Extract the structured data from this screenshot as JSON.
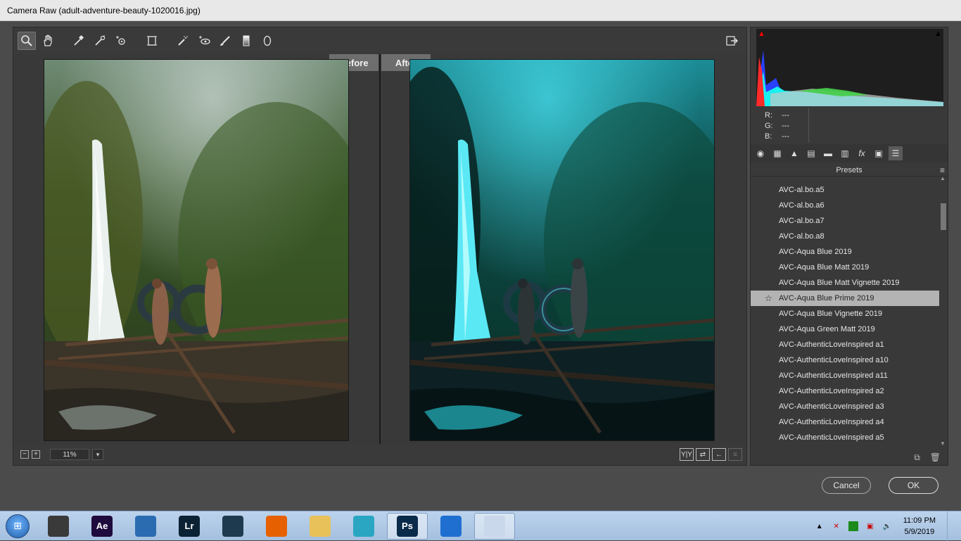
{
  "window": {
    "title": "Camera Raw (adult-adventure-beauty-1020016.jpg)"
  },
  "tools": [
    {
      "name": "zoom-tool",
      "icon": "magnifier-icon"
    },
    {
      "name": "hand-tool",
      "icon": "hand-icon"
    },
    {
      "name": "white-balance-tool",
      "icon": "eyedropper-icon"
    },
    {
      "name": "color-sampler-tool",
      "icon": "color-sampler-icon"
    },
    {
      "name": "targeted-adjustment-tool",
      "icon": "target-adjust-icon"
    },
    {
      "name": "transform-tool",
      "icon": "transform-icon"
    },
    {
      "name": "spot-removal-tool",
      "icon": "spot-removal-icon"
    },
    {
      "name": "red-eye-tool",
      "icon": "red-eye-icon"
    },
    {
      "name": "adjustment-brush-tool",
      "icon": "brush-icon"
    },
    {
      "name": "graduated-filter-tool",
      "icon": "graduated-filter-icon"
    },
    {
      "name": "radial-filter-tool",
      "icon": "radial-filter-icon"
    }
  ],
  "view": {
    "before_label": "Before",
    "after_label": "After",
    "zoom": "11%"
  },
  "readout": {
    "r_label": "R:",
    "r_value": "---",
    "g_label": "G:",
    "g_value": "---",
    "b_label": "B:",
    "b_value": "---"
  },
  "presets": {
    "title": "Presets",
    "items": [
      "AVC-al.bo.a5",
      "AVC-al.bo.a6",
      "AVC-al.bo.a7",
      "AVC-al.bo.a8",
      "AVC-Aqua Blue 2019",
      "AVC-Aqua Blue Matt 2019",
      "AVC-Aqua Blue Matt Vignette 2019",
      "AVC-Aqua Blue Prime 2019",
      "AVC-Aqua Blue Vignette 2019",
      "AVC-Aqua Green Matt 2019",
      "AVC-AuthenticLoveInspired a1",
      "AVC-AuthenticLoveInspired a10",
      "AVC-AuthenticLoveInspired a11",
      "AVC-AuthenticLoveInspired a2",
      "AVC-AuthenticLoveInspired a3",
      "AVC-AuthenticLoveInspired a4",
      "AVC-AuthenticLoveInspired a5"
    ],
    "selected_index": 7
  },
  "buttons": {
    "cancel": "Cancel",
    "ok": "OK"
  },
  "taskbar": {
    "apps": [
      {
        "name": "movie-maker",
        "label": "",
        "color": "#3a3a3a"
      },
      {
        "name": "after-effects",
        "label": "Ae",
        "color": "#1f0a3d"
      },
      {
        "name": "blender-like",
        "label": "",
        "color": "#2b6cb0"
      },
      {
        "name": "lightroom",
        "label": "Lr",
        "color": "#0b2234"
      },
      {
        "name": "filmora",
        "label": "",
        "color": "#1d3a4f"
      },
      {
        "name": "firefox",
        "label": "",
        "color": "#e66000"
      },
      {
        "name": "file-explorer",
        "label": "",
        "color": "#e8c15a"
      },
      {
        "name": "screen-recorder",
        "label": "",
        "color": "#2aa6c2"
      },
      {
        "name": "photoshop",
        "label": "Ps",
        "color": "#0a2a4a"
      },
      {
        "name": "teamviewer",
        "label": "",
        "color": "#1f6fd1"
      },
      {
        "name": "paint",
        "label": "",
        "color": "#c9d8ea"
      }
    ],
    "time": "11:09 PM",
    "date": "5/9/2019"
  },
  "colors": {
    "accent_before_tab": "#6e6e6e",
    "selected_preset": "#b3b3b3",
    "histogram_red": "#ff2a2a",
    "histogram_cyan": "#19f0f0",
    "histogram_blue": "#2a40ff"
  }
}
